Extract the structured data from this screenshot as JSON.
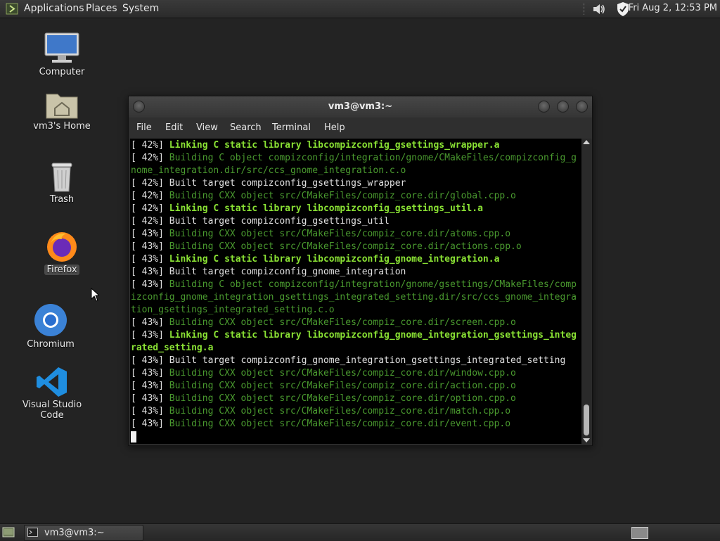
{
  "top_panel": {
    "menus": [
      "Applications",
      "Places",
      "System"
    ],
    "clock": "Fri Aug  2, 12:53 PM",
    "icons": [
      "distro-icon",
      "volume-icon",
      "shield-icon"
    ]
  },
  "desktop": {
    "icons": [
      {
        "label": "Computer",
        "icon": "computer-icon"
      },
      {
        "label": "vm3's Home",
        "icon": "home-folder-icon"
      },
      {
        "label": "Trash",
        "icon": "trash-icon"
      },
      {
        "label": "Firefox",
        "icon": "firefox-icon"
      },
      {
        "label": "Chromium",
        "icon": "chromium-icon"
      },
      {
        "label": "Visual Studio Code",
        "icon": "vscode-icon"
      }
    ]
  },
  "terminal": {
    "title": "vm3@vm3:~",
    "menu": [
      "File",
      "Edit",
      "View",
      "Search",
      "Terminal",
      "Help"
    ],
    "lines": [
      {
        "type": "link",
        "pct": "[ 42%]",
        "msg": "Linking C static library libcompizconfig_gsettings_wrapper.a"
      },
      {
        "type": "build",
        "pct": "[ 42%]",
        "msg": "Building C object compizconfig/integration/gnome/CMakeFiles/compizconfig_gnome_integration.dir/src/ccs_gnome_integration.c.o"
      },
      {
        "type": "built",
        "pct": "[ 42%]",
        "msg": "Built target compizconfig_gsettings_wrapper"
      },
      {
        "type": "build",
        "pct": "[ 42%]",
        "msg": "Building CXX object src/CMakeFiles/compiz_core.dir/global.cpp.o"
      },
      {
        "type": "link",
        "pct": "[ 42%]",
        "msg": "Linking C static library libcompizconfig_gsettings_util.a"
      },
      {
        "type": "built",
        "pct": "[ 42%]",
        "msg": "Built target compizconfig_gsettings_util"
      },
      {
        "type": "build",
        "pct": "[ 43%]",
        "msg": "Building CXX object src/CMakeFiles/compiz_core.dir/atoms.cpp.o"
      },
      {
        "type": "build",
        "pct": "[ 43%]",
        "msg": "Building CXX object src/CMakeFiles/compiz_core.dir/actions.cpp.o"
      },
      {
        "type": "link",
        "pct": "[ 43%]",
        "msg": "Linking C static library libcompizconfig_gnome_integration.a"
      },
      {
        "type": "built",
        "pct": "[ 43%]",
        "msg": "Built target compizconfig_gnome_integration"
      },
      {
        "type": "build",
        "pct": "[ 43%]",
        "msg": "Building C object compizconfig/integration/gnome/gsettings/CMakeFiles/compizconfig_gnome_integration_gsettings_integrated_setting.dir/src/ccs_gnome_integration_gsettings_integrated_setting.c.o"
      },
      {
        "type": "build",
        "pct": "[ 43%]",
        "msg": "Building CXX object src/CMakeFiles/compiz_core.dir/screen.cpp.o"
      },
      {
        "type": "link",
        "pct": "[ 43%]",
        "msg": "Linking C static library libcompizconfig_gnome_integration_gsettings_integrated_setting.a"
      },
      {
        "type": "built",
        "pct": "[ 43%]",
        "msg": "Built target compizconfig_gnome_integration_gsettings_integrated_setting"
      },
      {
        "type": "build",
        "pct": "[ 43%]",
        "msg": "Building CXX object src/CMakeFiles/compiz_core.dir/window.cpp.o"
      },
      {
        "type": "build",
        "pct": "[ 43%]",
        "msg": "Building CXX object src/CMakeFiles/compiz_core.dir/action.cpp.o"
      },
      {
        "type": "build",
        "pct": "[ 43%]",
        "msg": "Building CXX object src/CMakeFiles/compiz_core.dir/option.cpp.o"
      },
      {
        "type": "build",
        "pct": "[ 43%]",
        "msg": "Building CXX object src/CMakeFiles/compiz_core.dir/match.cpp.o"
      },
      {
        "type": "build",
        "pct": "[ 43%]",
        "msg": "Building CXX object src/CMakeFiles/compiz_core.dir/event.cpp.o"
      }
    ]
  },
  "bottom_panel": {
    "task_label": "vm3@vm3:~"
  },
  "colors": {
    "build_text": "#4a9a2f",
    "link_text": "#8ae234",
    "normal_text": "#e0e0e0"
  }
}
